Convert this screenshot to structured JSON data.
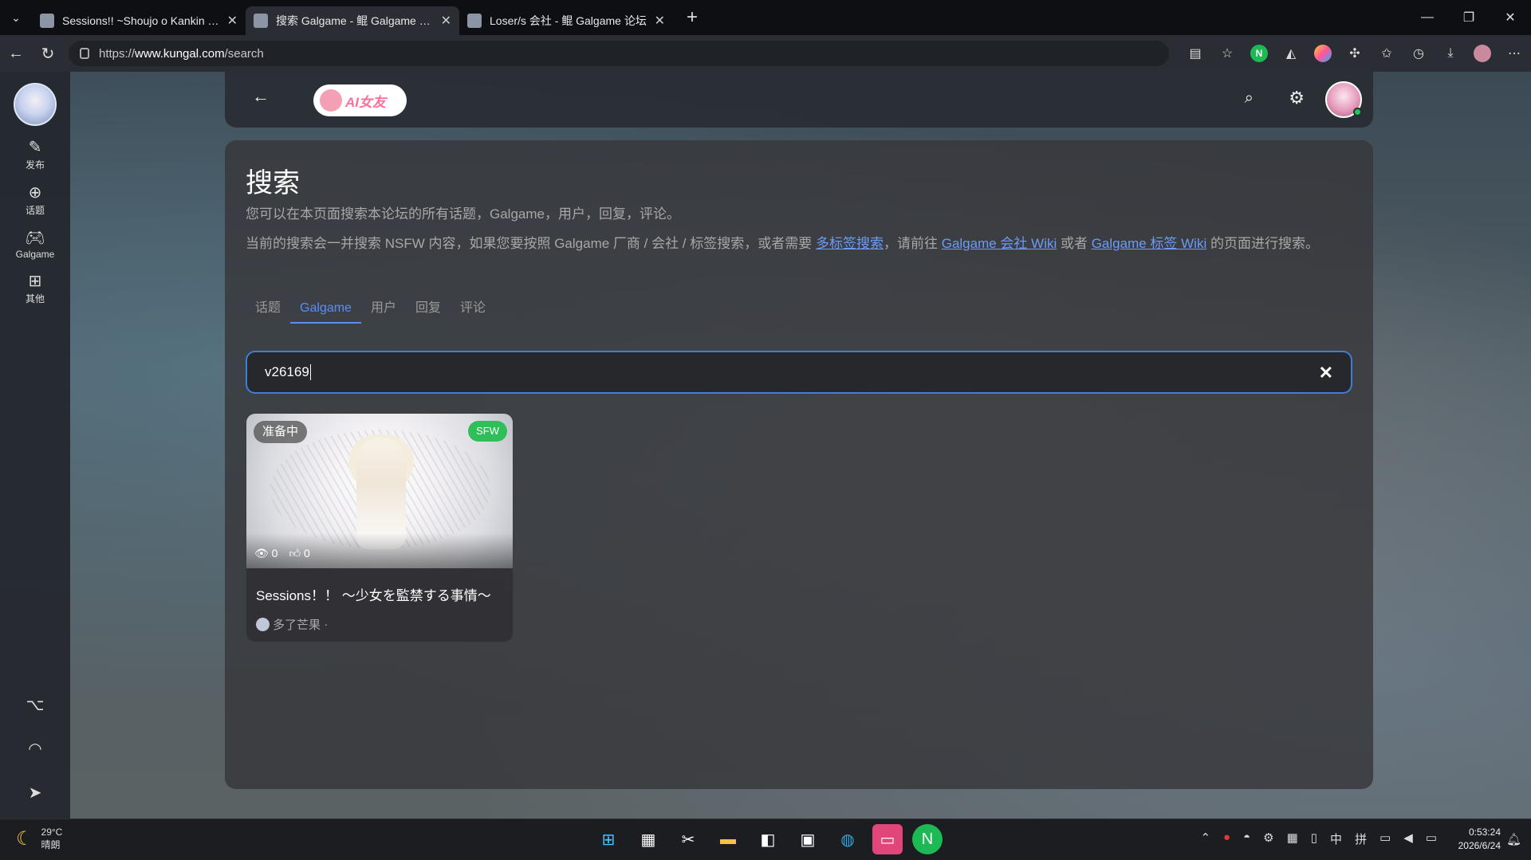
{
  "browser": {
    "tabs": [
      {
        "title": "Sessions!! ~Shoujo o Kankin Suru",
        "active": false
      },
      {
        "title": "搜索 Galgame - 鲲 Galgame 论坛",
        "active": true
      },
      {
        "title": "Loser/s 会社 - 鲲 Galgame 论坛",
        "active": false
      }
    ],
    "url_prefix": "https://",
    "url_host": "www.kungal.com",
    "url_path": "/search"
  },
  "sidebar": {
    "items": [
      {
        "label": "发布",
        "icon": "pencil-icon"
      },
      {
        "label": "话题",
        "icon": "topic-icon"
      },
      {
        "label": "Galgame",
        "icon": "gamepad-icon"
      },
      {
        "label": "其他",
        "icon": "grid-icon"
      }
    ]
  },
  "topbar": {
    "ai_badge_label": "AI女友"
  },
  "page": {
    "title": "搜索",
    "description": "您可以在本页面搜索本论坛的所有话题，Galgame，用户，回复，评论。",
    "notice_before": "当前的搜索会一并搜索 NSFW 内容，如果您要按照 Galgame 厂商 / 会社 / 标签搜索，或者需要 ",
    "link_multi_tag": "多标签搜索",
    "notice_mid1": "，请前往 ",
    "link_company_wiki": "Galgame 会社 Wiki",
    "notice_mid2": " 或者 ",
    "link_tag_wiki": "Galgame 标签 Wiki",
    "notice_after": " 的页面进行搜索。",
    "tabs": [
      "话题",
      "Galgame",
      "用户",
      "回复",
      "评论"
    ],
    "active_tab": "Galgame",
    "search_value": "v26169"
  },
  "result": {
    "status": "准备中",
    "rating": "SFW",
    "views": "0",
    "likes": "0",
    "title": "Sessions！！ ～少女を監禁する事情～",
    "author": "多了芒果",
    "author_suffix": "·"
  },
  "taskbar": {
    "temperature": "29°C",
    "weather": "晴朗",
    "ime1": "中",
    "ime2": "拼",
    "time": "0:53:24",
    "date": "2026/6/24"
  },
  "colors": {
    "accent": "#5b8ef0",
    "search_border": "#3f7fd8",
    "sfw_green": "#2fbf5a",
    "online_dot": "#21c55d"
  }
}
